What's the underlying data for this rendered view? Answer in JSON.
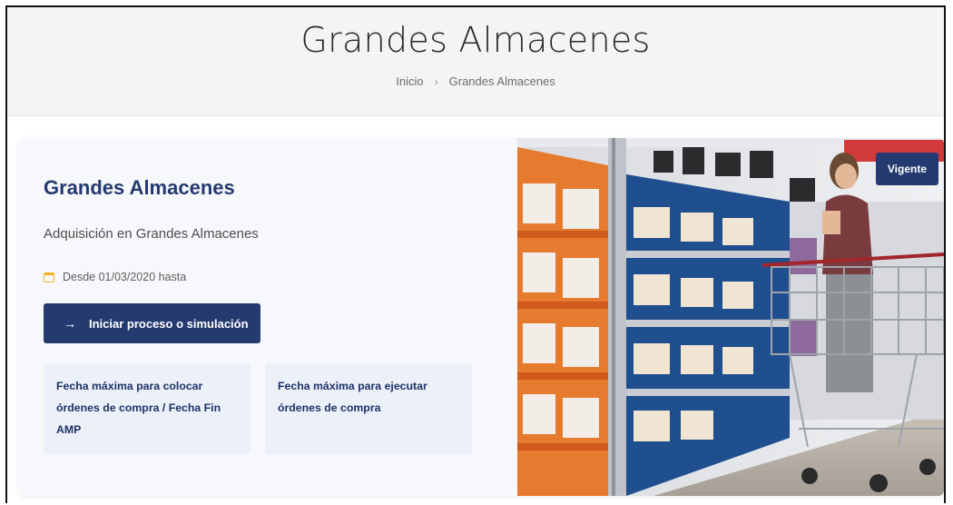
{
  "header": {
    "title": "Grandes Almacenes",
    "breadcrumb": {
      "home": "Inicio",
      "separator": "›",
      "current": "Grandes Almacenes"
    }
  },
  "card": {
    "title": "Grandes Almacenes",
    "subtitle": "Adquisición en Grandes Almacenes",
    "date_text": "Desde 01/03/2020 hasta",
    "start_button": "Iniciar proceso o simulación",
    "info_boxes": [
      {
        "label": "Fecha máxima para colocar órdenes de compra / Fecha Fin AMP"
      },
      {
        "label": "Fecha máxima para ejecutar órdenes de compra"
      }
    ],
    "status_badge": "Vigente"
  },
  "colors": {
    "primary": "#243a70",
    "accent": "#f3b422",
    "card_bg": "#f7f8fb",
    "info_bg": "#ecf0f9"
  },
  "icons": {
    "calendar": "calendar-icon",
    "arrow": "arrow-right-icon",
    "breadcrumb_separator": "chevron-right-icon"
  }
}
